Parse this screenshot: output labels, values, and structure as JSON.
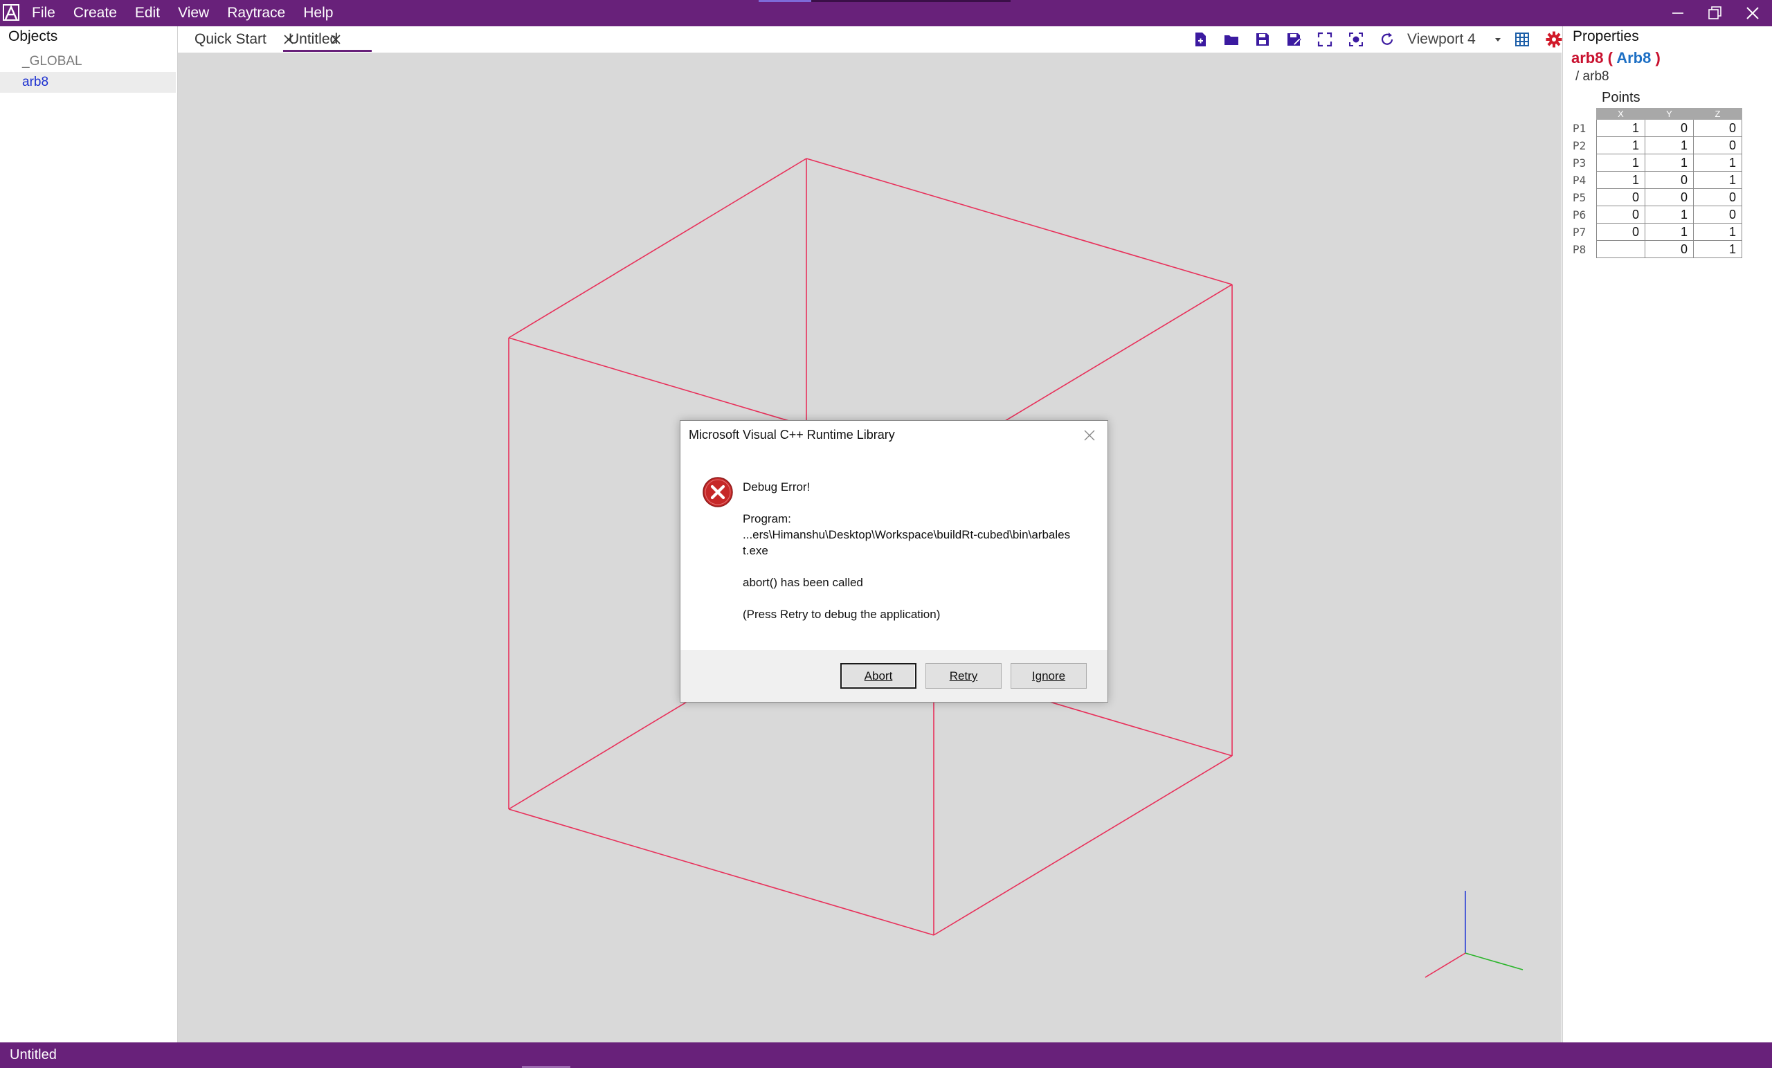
{
  "menu": {
    "items": [
      "File",
      "Create",
      "Edit",
      "View",
      "Raytrace",
      "Help"
    ]
  },
  "window_controls": {
    "minimize": "minimize-icon",
    "restore": "restore-icon",
    "close": "close-icon"
  },
  "objects_panel": {
    "title": "Objects",
    "items": [
      "_GLOBAL",
      "arb8"
    ]
  },
  "tabs": [
    {
      "label": "Quick Start",
      "active": false
    },
    {
      "label": "Untitled",
      "active": true
    }
  ],
  "toolbar": {
    "icons": [
      "new-file-icon",
      "open-folder-icon",
      "save-icon",
      "save-as-icon",
      "fullscreen-icon",
      "focus-icon",
      "refresh-icon",
      "grid-icon",
      "settings-icon"
    ],
    "viewport_label": "Viewport 4"
  },
  "properties": {
    "title": "Properties",
    "object_name": "arb8",
    "object_type": "Arb8",
    "path": "/ arb8",
    "points_label": "Points",
    "columns": [
      "X",
      "Y",
      "Z"
    ],
    "rows": [
      {
        "name": "P1",
        "x": "1",
        "y": "0",
        "z": "0"
      },
      {
        "name": "P2",
        "x": "1",
        "y": "1",
        "z": "0"
      },
      {
        "name": "P3",
        "x": "1",
        "y": "1",
        "z": "1"
      },
      {
        "name": "P4",
        "x": "1",
        "y": "0",
        "z": "1"
      },
      {
        "name": "P5",
        "x": "0",
        "y": "0",
        "z": "0"
      },
      {
        "name": "P6",
        "x": "0",
        "y": "1",
        "z": "0"
      },
      {
        "name": "P7",
        "x": "0",
        "y": "1",
        "z": "1"
      },
      {
        "name": "P8",
        "x": "",
        "y": "0",
        "z": "1"
      }
    ]
  },
  "dialog": {
    "title": "Microsoft Visual C++ Runtime Library",
    "heading": "Debug Error!",
    "program_label": "Program:",
    "program_path_line1": "...ers\\Himanshu\\Desktop\\Workspace\\buildRt-cubed\\bin\\arbales",
    "program_path_line2": "t.exe",
    "message": "abort() has been called",
    "hint": "(Press Retry to debug the application)",
    "buttons": {
      "abort": "Abort",
      "retry": "Retry",
      "ignore": "Ignore"
    }
  },
  "status_bar": {
    "text": "Untitled"
  },
  "colors": {
    "brand": "#68217a",
    "wireframe": "#e8305a",
    "object_name": "#c8102e",
    "object_type": "#1d6fc4",
    "selected_item": "#1b2fd0",
    "axis_x": "#e8305a",
    "axis_y": "#2ab52a",
    "axis_z": "#2a3fd6"
  }
}
